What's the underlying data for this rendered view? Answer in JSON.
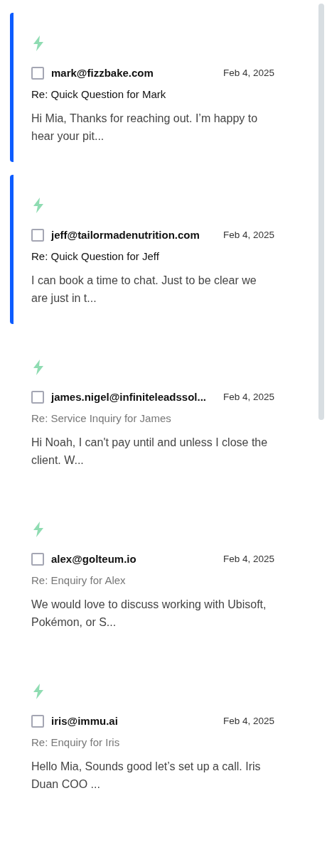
{
  "emails": [
    {
      "unread": true,
      "checked": false,
      "sender": "mark@fizzbake.com",
      "date": "Feb 4, 2025",
      "subject": "Re: Quick Question for Mark",
      "preview": "Hi Mia, Thanks for reaching out. I’m happy to hear your pit..."
    },
    {
      "unread": true,
      "checked": false,
      "sender": "jeff@tailormadenutrition.com",
      "date": "Feb 4, 2025",
      "subject": "Re: Quick Question for Jeff",
      "preview": "I can book a time to chat. Just to be clear we are just in t..."
    },
    {
      "unread": false,
      "checked": false,
      "sender": "james.nigel@infiniteleadssol...",
      "date": "Feb 4, 2025",
      "subject": "Re: Service Inquiry for James",
      "preview": "Hi Noah, I can't pay until and unless I close the client. W..."
    },
    {
      "unread": false,
      "checked": false,
      "sender": "alex@golteum.io",
      "date": "Feb 4, 2025",
      "subject": "Re: Enquiry for Alex",
      "preview": "We would love to discuss working with Ubisoft, Pokémon, or S..."
    },
    {
      "unread": false,
      "checked": false,
      "sender": "iris@immu.ai",
      "date": "Feb 4, 2025",
      "subject": "Re: Enquiry for Iris",
      "preview": "Hello Mia, Sounds good let’s set up a call. Iris Duan COO ..."
    }
  ]
}
